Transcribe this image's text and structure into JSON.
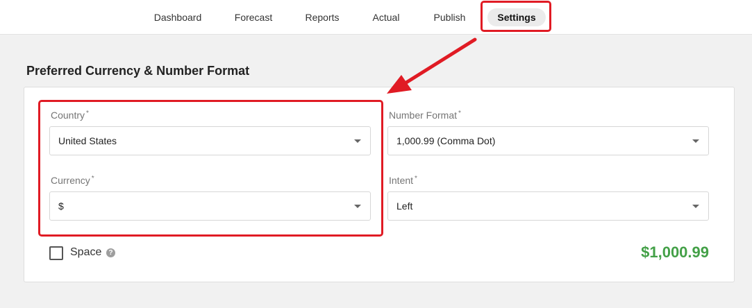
{
  "nav": {
    "tabs": [
      {
        "label": "Dashboard"
      },
      {
        "label": "Forecast"
      },
      {
        "label": "Reports"
      },
      {
        "label": "Actual"
      },
      {
        "label": "Publish"
      },
      {
        "label": "Settings"
      }
    ],
    "active_tab": "Settings"
  },
  "section": {
    "title": "Preferred Currency & Number Format"
  },
  "form": {
    "required_marker": "*",
    "country": {
      "label": "Country",
      "value": "United States"
    },
    "currency": {
      "label": "Currency",
      "value": "$"
    },
    "number_format": {
      "label": "Number Format",
      "value": "1,000.99 (Comma Dot)"
    },
    "intent": {
      "label": "Intent",
      "value": "Left"
    },
    "space": {
      "label": "Space",
      "checked": false,
      "help_glyph": "?"
    },
    "preview": "$1,000.99"
  },
  "colors": {
    "accent_green": "#43a047",
    "annotation_red": "#e01b24"
  },
  "icons": {
    "dropdown": "chevron-down-icon",
    "help": "help-circle-icon",
    "annotation": "arrow-annotation"
  }
}
